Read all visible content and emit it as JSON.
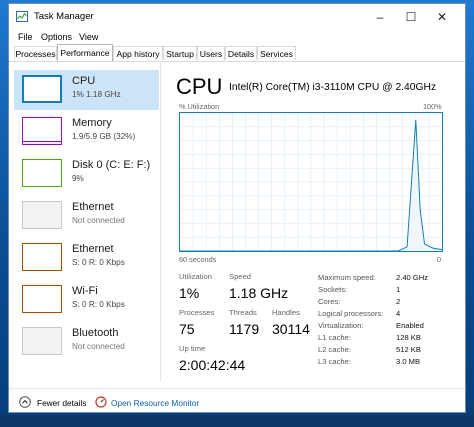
{
  "window": {
    "title": "Task Manager",
    "controls": [
      "–",
      "☐",
      "✕"
    ]
  },
  "menu": [
    "File",
    "Options",
    "View"
  ],
  "tabs": [
    {
      "label": "Processes",
      "active": false
    },
    {
      "label": "Performance",
      "active": true
    },
    {
      "label": "App history",
      "active": false
    },
    {
      "label": "Startup",
      "active": false
    },
    {
      "label": "Users",
      "active": false
    },
    {
      "label": "Details",
      "active": false
    },
    {
      "label": "Services",
      "active": false
    }
  ],
  "sidebar": {
    "items": [
      {
        "title": "CPU",
        "sub": "1%  1.18 GHz",
        "color": "#117dbb",
        "selected": true
      },
      {
        "title": "Memory",
        "sub": "1.9/5.9 GB (32%)",
        "color": "#8b12ae",
        "selected": false
      },
      {
        "title": "Disk 0 (C: E: F:)",
        "sub": "9%",
        "color": "#4da60c",
        "selected": false
      },
      {
        "title": "Ethernet",
        "sub": "Not connected",
        "color": "#a74f01",
        "selected": false
      },
      {
        "title": "Ethernet",
        "sub": "S: 0  R: 0 Kbps",
        "color": "#a74f01",
        "selected": false
      },
      {
        "title": "Wi-Fi",
        "sub": "S: 0  R: 0 Kbps",
        "color": "#a74f01",
        "selected": false
      },
      {
        "title": "Bluetooth",
        "sub": "Not connected",
        "color": "#a74f01",
        "selected": false
      }
    ]
  },
  "main": {
    "heading": "CPU",
    "model": "Intel(R) Core(TM) i3-3110M CPU @ 2.40GHz",
    "y_label": "% Utilization",
    "y_max": "100%",
    "x_label": "60 seconds",
    "x_end": "0",
    "stats": {
      "utilization_label": "Utilization",
      "utilization": "1%",
      "speed_label": "Speed",
      "speed": "1.18 GHz",
      "processes_label": "Processes",
      "processes": "75",
      "threads_label": "Threads",
      "threads": "1179",
      "handles_label": "Handles",
      "handles": "30114",
      "uptime_label": "Up time",
      "uptime": "2:00:42:44"
    },
    "details": [
      {
        "k": "Maximum speed:",
        "v": "2.40 GHz"
      },
      {
        "k": "Sockets:",
        "v": "1"
      },
      {
        "k": "Cores:",
        "v": "2"
      },
      {
        "k": "Logical processors:",
        "v": "4"
      },
      {
        "k": "Virtualization:",
        "v": "Enabled"
      },
      {
        "k": "L1 cache:",
        "v": "128 KB"
      },
      {
        "k": "L2 cache:",
        "v": "512 KB"
      },
      {
        "k": "L3 cache:",
        "v": "3.0 MB"
      }
    ]
  },
  "footer": {
    "fewer_details": "Fewer details",
    "open_monitor": "Open Resource Monitor"
  },
  "chart_data": {
    "type": "area",
    "ylim": [
      0,
      100
    ],
    "x_seconds": [
      60,
      10,
      8,
      6,
      5,
      4,
      2,
      0
    ],
    "values": [
      0,
      0,
      3,
      95,
      30,
      5,
      2,
      1
    ]
  }
}
